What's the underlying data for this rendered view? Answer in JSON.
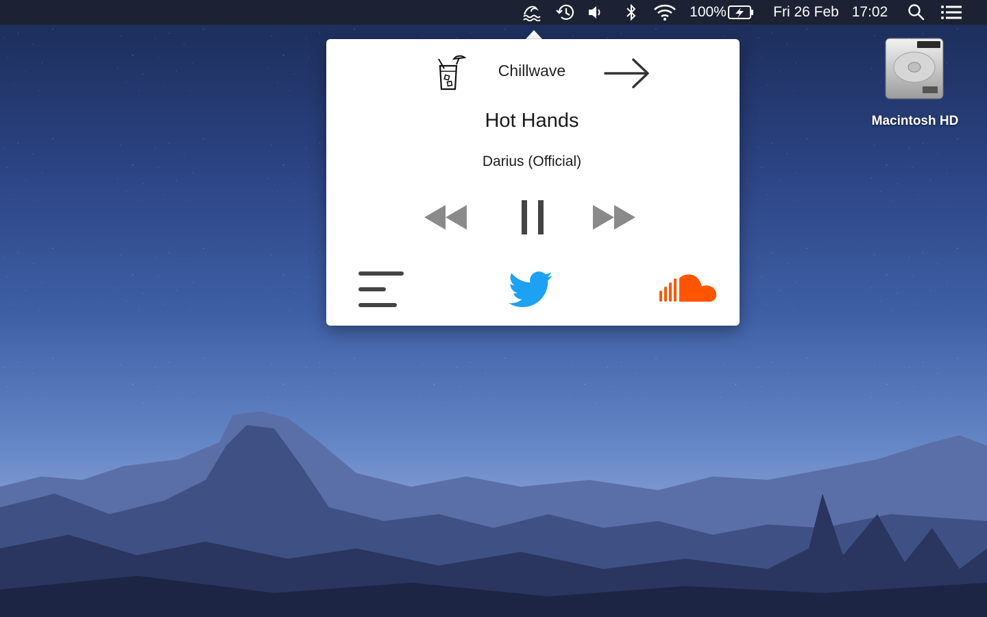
{
  "menubar": {
    "battery_percent": "100%",
    "date": "Fri 26 Feb",
    "time": "17:02",
    "icons": [
      "wave-app-icon",
      "time-machine-icon",
      "volume-icon",
      "bluetooth-icon",
      "wifi-icon",
      "battery-charging-icon",
      "spotlight-search-icon",
      "notification-center-icon"
    ]
  },
  "player": {
    "station": "Chillwave",
    "station_icon": "cocktail-glass-icon",
    "next_station_icon": "arrow-right-icon",
    "track_title": "Hot Hands",
    "artist": "Darius (Official)",
    "controls": [
      "rewind-icon",
      "pause-icon",
      "fast-forward-icon"
    ],
    "bottom_actions": [
      "menu-lines-icon",
      "twitter-icon",
      "soundcloud-icon"
    ],
    "colors": {
      "twitter": "#1da1f2",
      "soundcloud": "#ff5500",
      "controls": "#8a8a8a",
      "pause": "#444444"
    }
  },
  "desktop": {
    "drive_label": "Macintosh HD"
  }
}
